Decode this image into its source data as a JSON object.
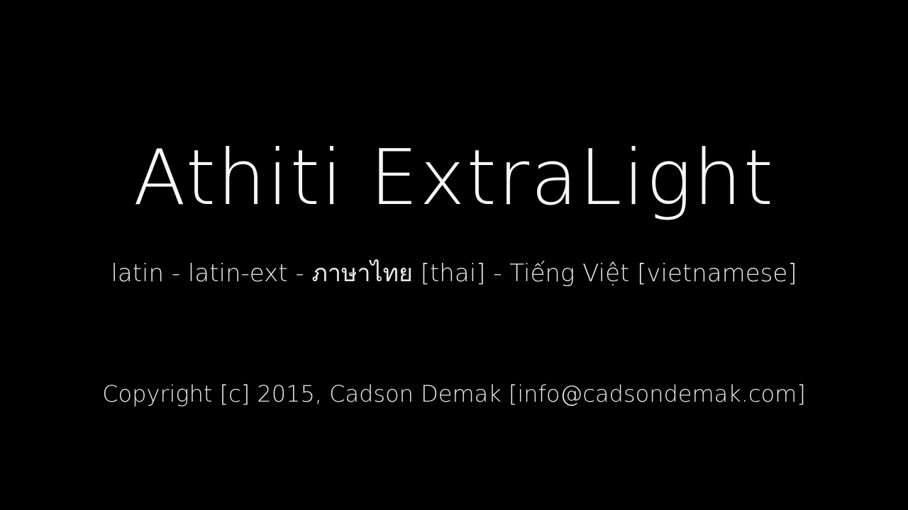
{
  "title": "Athiti ExtraLight",
  "scripts_line": "latin - latin-ext - ภาษาไทย [thai] - Tiếng Việt [vietnamese]",
  "copyright": "Copyright [c] 2015, Cadson Demak [info@cadsondemak.com]",
  "colors": {
    "background": "#000000",
    "text": "#ffffff"
  }
}
